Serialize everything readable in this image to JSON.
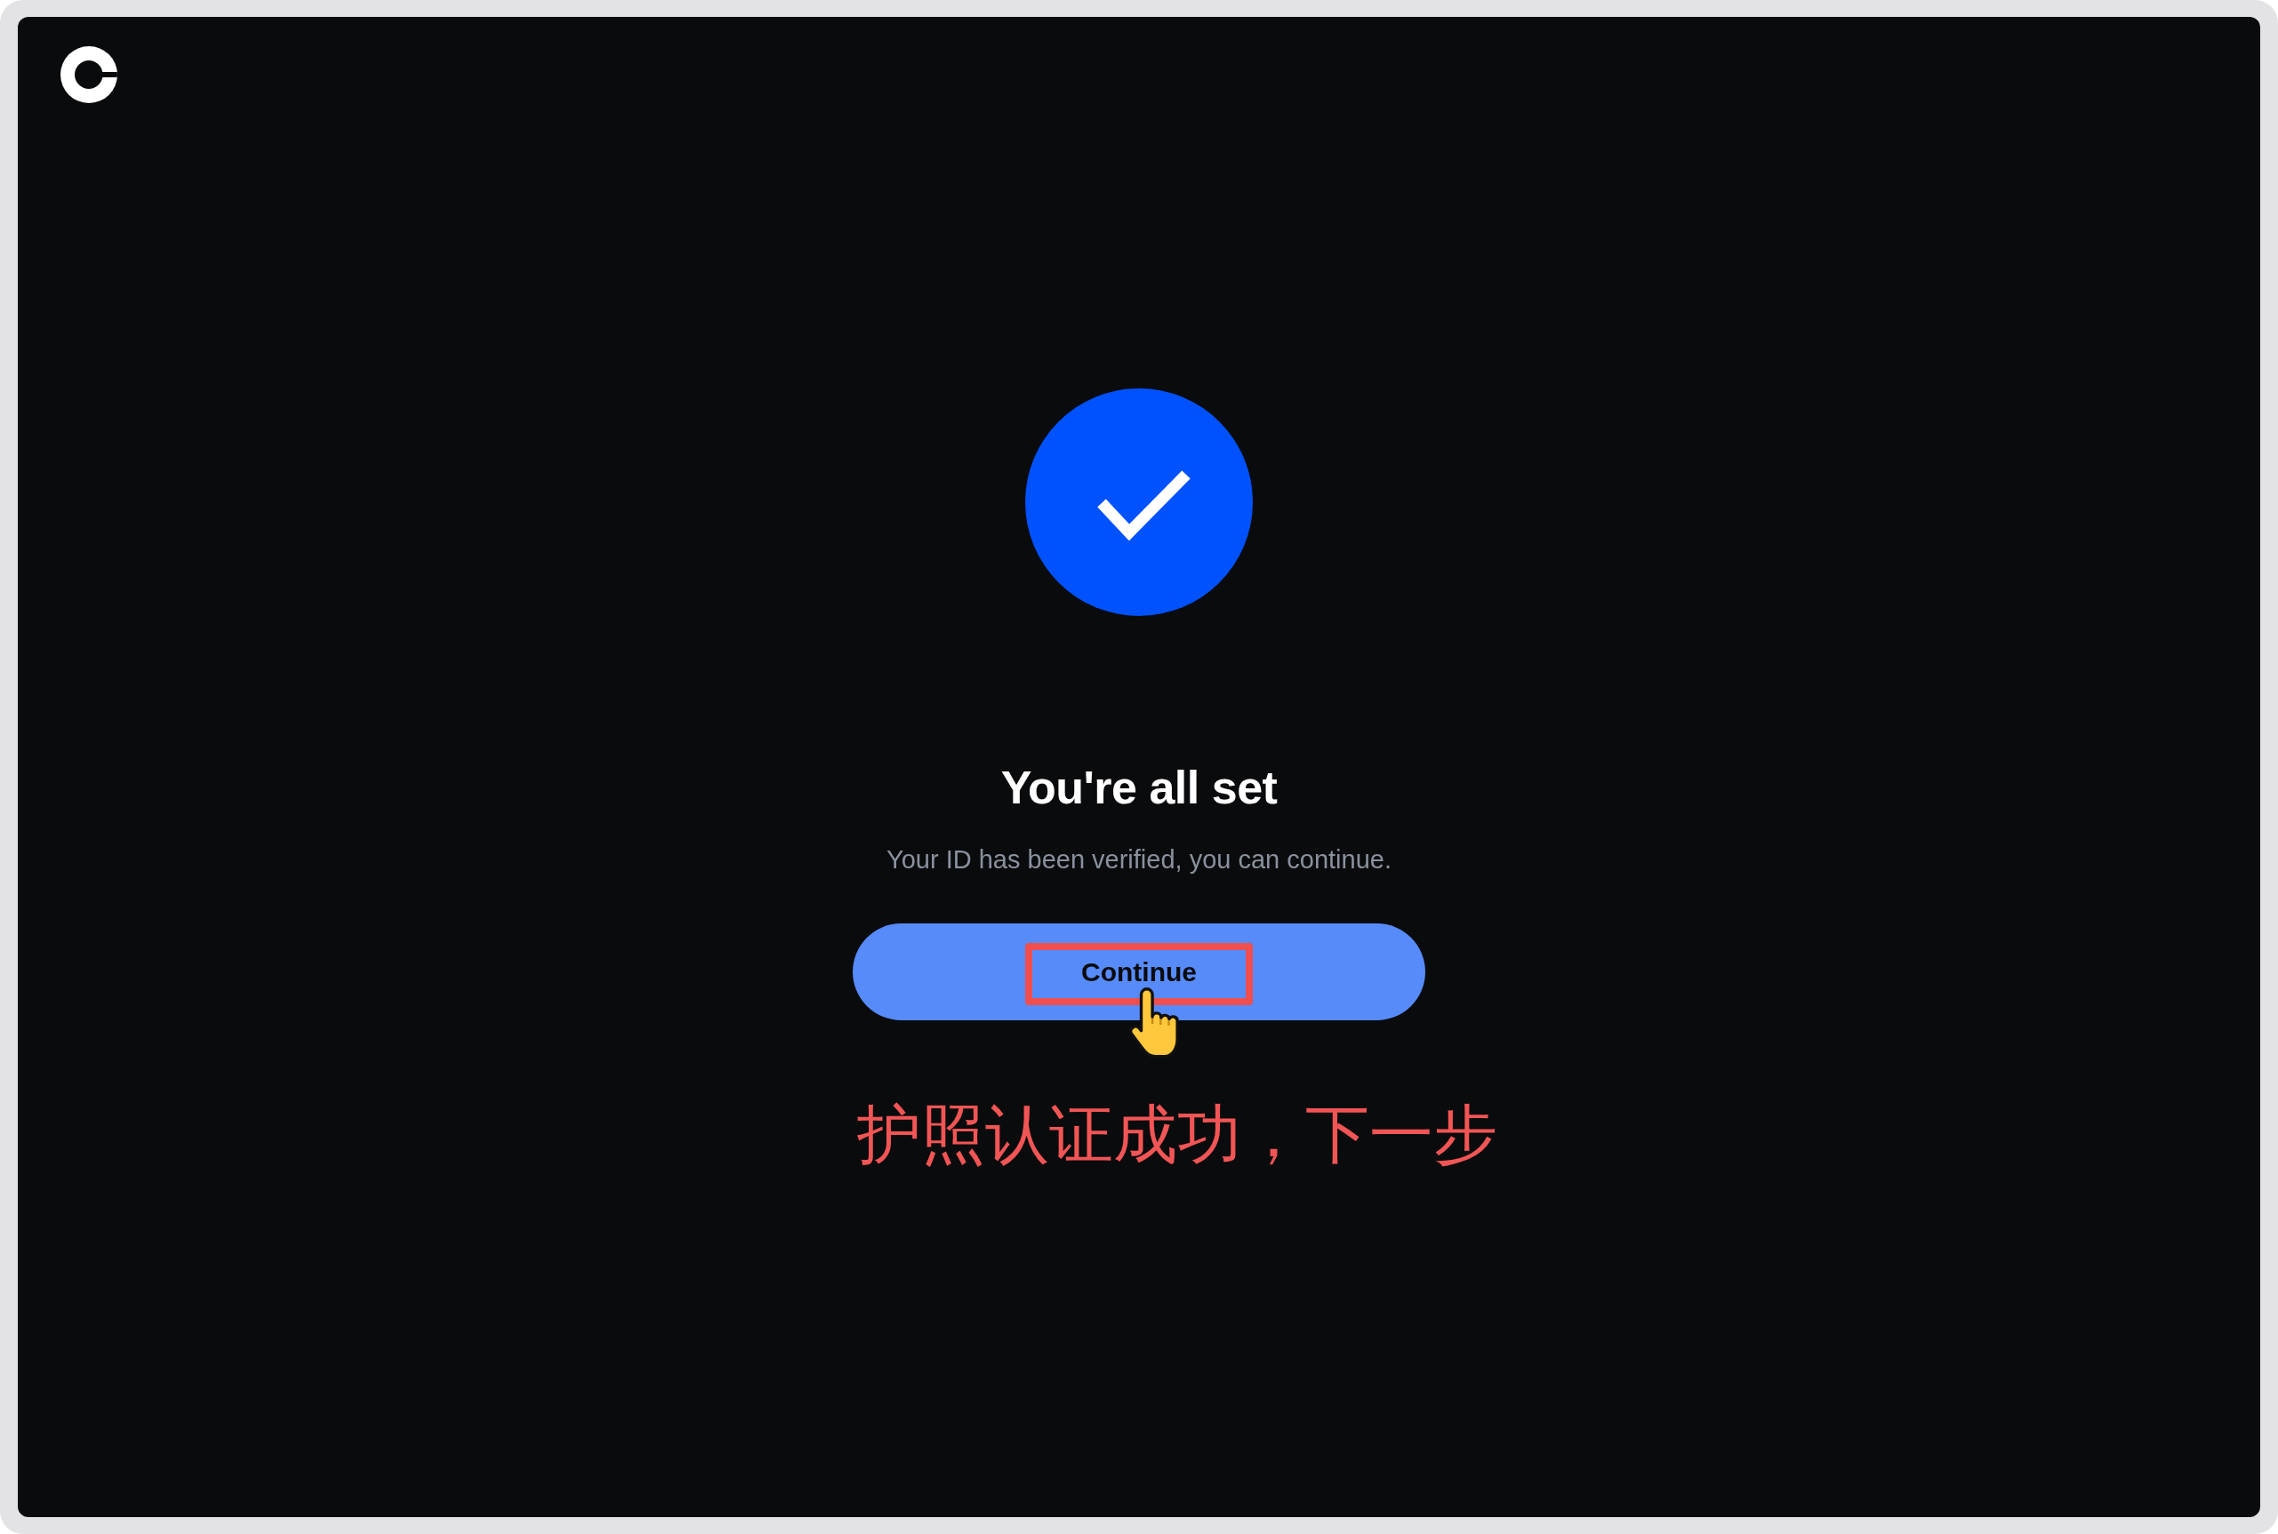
{
  "title": "You're all set",
  "message": "Your ID has been verified, you can continue.",
  "button": {
    "label": "Continue"
  },
  "annotation": {
    "highlight_box": true,
    "pointer_cursor": true,
    "caption": "护照认证成功，下一步"
  }
}
